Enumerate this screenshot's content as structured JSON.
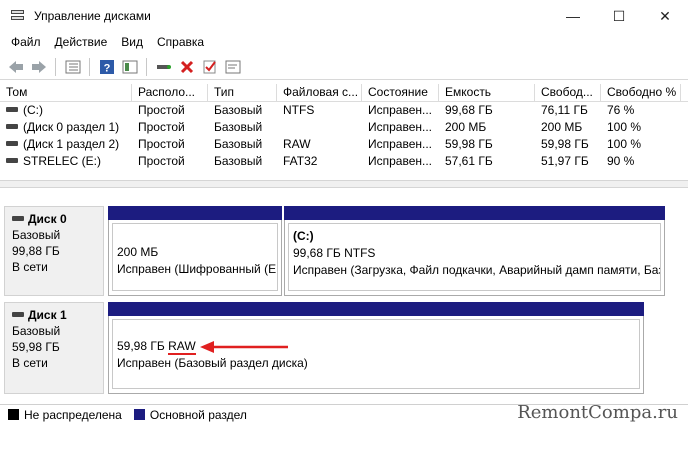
{
  "window": {
    "title": "Управление дисками",
    "minimize": "—",
    "maximize": "☐",
    "close": "✕"
  },
  "menu": [
    "Файл",
    "Действие",
    "Вид",
    "Справка"
  ],
  "toolbar": {
    "icons": [
      "back-icon",
      "forward-icon",
      "list-icon",
      "help-icon",
      "panel-icon",
      "connect-icon",
      "delete-icon",
      "check-icon",
      "properties-icon"
    ]
  },
  "volumes": {
    "headers": [
      "Том",
      "Располо...",
      "Тип",
      "Файловая с...",
      "Состояние",
      "Емкость",
      "Свобод...",
      "Свободно %"
    ],
    "rows": [
      [
        "(C:)",
        "Простой",
        "Базовый",
        "NTFS",
        "Исправен...",
        "99,68 ГБ",
        "76,11 ГБ",
        "76 %"
      ],
      [
        "(Диск 0 раздел 1)",
        "Простой",
        "Базовый",
        "",
        "Исправен...",
        "200 МБ",
        "200 МБ",
        "100 %"
      ],
      [
        "(Диск 1 раздел 2)",
        "Простой",
        "Базовый",
        "RAW",
        "Исправен...",
        "59,98 ГБ",
        "59,98 ГБ",
        "100 %"
      ],
      [
        "STRELEC (E:)",
        "Простой",
        "Базовый",
        "FAT32",
        "Исправен...",
        "57,61 ГБ",
        "51,97 ГБ",
        "90 %"
      ]
    ]
  },
  "disks": [
    {
      "name": "Диск 0",
      "type": "Базовый",
      "size": "99,88 ГБ",
      "status": "В сети",
      "partitions": [
        {
          "label": "",
          "size": "200 МБ",
          "status": "Исправен (Шифрованный (EFI"
        },
        {
          "label": "(C:)",
          "size": "99,68 ГБ NTFS",
          "status": "Исправен (Загрузка, Файл подкачки, Аварийный дамп памяти, Баз"
        }
      ]
    },
    {
      "name": "Диск 1",
      "type": "Базовый",
      "size": "59,98 ГБ",
      "status": "В сети",
      "partitions": [
        {
          "size": "59,98 ГБ",
          "fs": "RAW",
          "status": "Исправен (Базовый раздел диска)"
        }
      ]
    }
  ],
  "legend": [
    {
      "label": "Не распределена",
      "color": "#000000"
    },
    {
      "label": "Основной раздел",
      "color": "#1c1c80"
    }
  ],
  "watermark": "RemontCompa.ru",
  "colors": {
    "primary_partition": "#1c1c80",
    "annotation_arrow": "#e02020"
  }
}
